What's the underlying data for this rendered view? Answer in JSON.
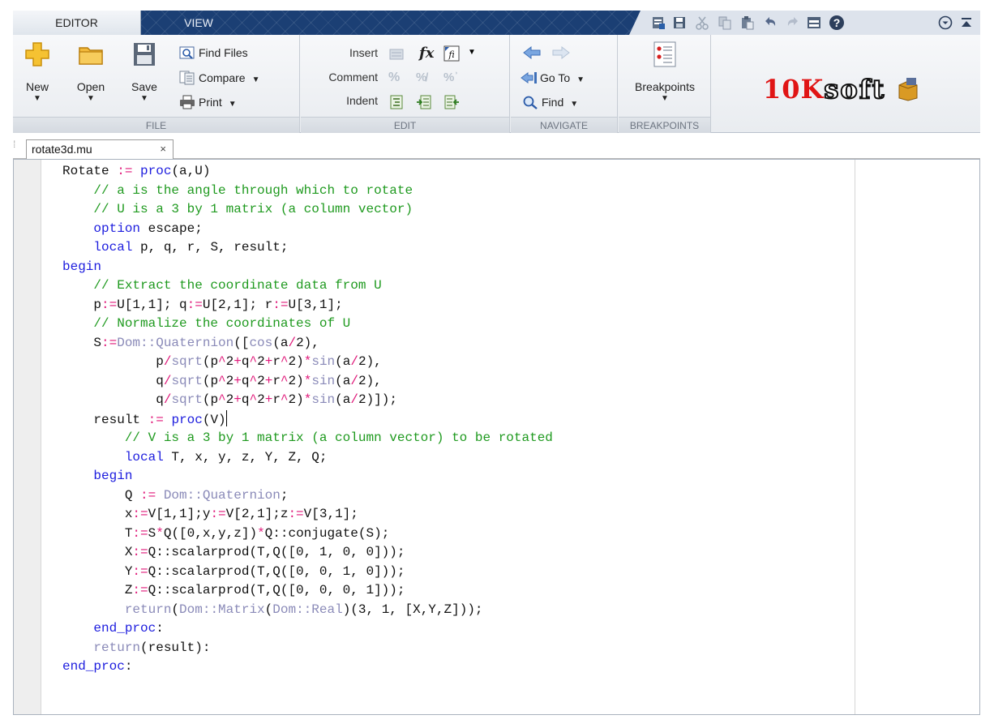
{
  "tabs": [
    {
      "label": "EDITOR"
    },
    {
      "label": "VIEW"
    }
  ],
  "quick_access": [
    "new-doc-icon",
    "save-icon",
    "cut-icon",
    "copy-icon",
    "paste-icon",
    "undo-icon",
    "redo-icon",
    "window-icon",
    "help-icon",
    "menu-chevron-icon",
    "collapse-icon"
  ],
  "ribbon": {
    "file": {
      "label": "FILE",
      "new": "New",
      "open": "Open",
      "save": "Save",
      "find_files": "Find Files",
      "compare": "Compare",
      "print": "Print"
    },
    "edit": {
      "label": "EDIT",
      "insert": "Insert",
      "comment": "Comment",
      "indent": "Indent"
    },
    "navigate": {
      "label": "NAVIGATE",
      "goto": "Go To",
      "find": "Find"
    },
    "breakpoints": {
      "label": "BREAKPOINTS",
      "button": "Breakpoints"
    }
  },
  "logo": {
    "text_a": "10K",
    "text_b": "soft"
  },
  "file_tab": {
    "name": "rotate3d.mu",
    "close": "×"
  },
  "colors": {
    "keyword": "#1d1dde",
    "comment": "#1f9a1f",
    "function": "#8a8ab8",
    "operator": "#e0197a"
  },
  "code_lines": [
    [
      [
        "tx",
        "Rotate "
      ],
      [
        "op",
        ":="
      ],
      [
        "tx",
        " "
      ],
      [
        "kw",
        "proc"
      ],
      [
        "tx",
        "(a,U)"
      ]
    ],
    [
      [
        "tx",
        "    "
      ],
      [
        "cm",
        "// a is the angle through which to rotate"
      ]
    ],
    [
      [
        "tx",
        "    "
      ],
      [
        "cm",
        "// U is a 3 by 1 matrix (a column vector)"
      ]
    ],
    [
      [
        "tx",
        "    "
      ],
      [
        "kw",
        "option"
      ],
      [
        "tx",
        " escape;"
      ]
    ],
    [
      [
        "tx",
        "    "
      ],
      [
        "kw",
        "local"
      ],
      [
        "tx",
        " p, q, r, S, result;"
      ]
    ],
    [
      [
        "kw",
        "begin"
      ]
    ],
    [
      [
        "tx",
        "    "
      ],
      [
        "cm",
        "// Extract the coordinate data from U"
      ]
    ],
    [
      [
        "tx",
        "    p"
      ],
      [
        "op",
        ":="
      ],
      [
        "tx",
        "U[1,1]; q"
      ],
      [
        "op",
        ":="
      ],
      [
        "tx",
        "U[2,1]; r"
      ],
      [
        "op",
        ":="
      ],
      [
        "tx",
        "U[3,1];"
      ]
    ],
    [
      [
        "tx",
        "    "
      ],
      [
        "cm",
        "// Normalize the coordinates of U"
      ]
    ],
    [
      [
        "tx",
        "    S"
      ],
      [
        "op",
        ":="
      ],
      [
        "fn",
        "Dom::Quaternion"
      ],
      [
        "tx",
        "(["
      ],
      [
        "fn",
        "cos"
      ],
      [
        "tx",
        "(a"
      ],
      [
        "op",
        "/"
      ],
      [
        "tx",
        "2),"
      ]
    ],
    [
      [
        "tx",
        "            p"
      ],
      [
        "op",
        "/"
      ],
      [
        "fn",
        "sqrt"
      ],
      [
        "tx",
        "(p"
      ],
      [
        "op",
        "^"
      ],
      [
        "tx",
        "2"
      ],
      [
        "op",
        "+"
      ],
      [
        "tx",
        "q"
      ],
      [
        "op",
        "^"
      ],
      [
        "tx",
        "2"
      ],
      [
        "op",
        "+"
      ],
      [
        "tx",
        "r"
      ],
      [
        "op",
        "^"
      ],
      [
        "tx",
        "2)"
      ],
      [
        "op",
        "*"
      ],
      [
        "fn",
        "sin"
      ],
      [
        "tx",
        "(a"
      ],
      [
        "op",
        "/"
      ],
      [
        "tx",
        "2),"
      ]
    ],
    [
      [
        "tx",
        "            q"
      ],
      [
        "op",
        "/"
      ],
      [
        "fn",
        "sqrt"
      ],
      [
        "tx",
        "(p"
      ],
      [
        "op",
        "^"
      ],
      [
        "tx",
        "2"
      ],
      [
        "op",
        "+"
      ],
      [
        "tx",
        "q"
      ],
      [
        "op",
        "^"
      ],
      [
        "tx",
        "2"
      ],
      [
        "op",
        "+"
      ],
      [
        "tx",
        "r"
      ],
      [
        "op",
        "^"
      ],
      [
        "tx",
        "2)"
      ],
      [
        "op",
        "*"
      ],
      [
        "fn",
        "sin"
      ],
      [
        "tx",
        "(a"
      ],
      [
        "op",
        "/"
      ],
      [
        "tx",
        "2),"
      ]
    ],
    [
      [
        "tx",
        "            q"
      ],
      [
        "op",
        "/"
      ],
      [
        "fn",
        "sqrt"
      ],
      [
        "tx",
        "(p"
      ],
      [
        "op",
        "^"
      ],
      [
        "tx",
        "2"
      ],
      [
        "op",
        "+"
      ],
      [
        "tx",
        "q"
      ],
      [
        "op",
        "^"
      ],
      [
        "tx",
        "2"
      ],
      [
        "op",
        "+"
      ],
      [
        "tx",
        "r"
      ],
      [
        "op",
        "^"
      ],
      [
        "tx",
        "2)"
      ],
      [
        "op",
        "*"
      ],
      [
        "fn",
        "sin"
      ],
      [
        "tx",
        "(a"
      ],
      [
        "op",
        "/"
      ],
      [
        "tx",
        "2)]);"
      ]
    ],
    [
      [
        "tx",
        "    result "
      ],
      [
        "op",
        ":="
      ],
      [
        "tx",
        " "
      ],
      [
        "kw",
        "proc"
      ],
      [
        "tx",
        "(V)"
      ],
      [
        "caret",
        ""
      ]
    ],
    [
      [
        "tx",
        "        "
      ],
      [
        "cm",
        "// V is a 3 by 1 matrix (a column vector) to be rotated"
      ]
    ],
    [
      [
        "tx",
        "        "
      ],
      [
        "kw",
        "local"
      ],
      [
        "tx",
        " T, x, y, z, Y, Z, Q;"
      ]
    ],
    [
      [
        "tx",
        "    "
      ],
      [
        "kw",
        "begin"
      ]
    ],
    [
      [
        "tx",
        "        Q "
      ],
      [
        "op",
        ":="
      ],
      [
        "tx",
        " "
      ],
      [
        "fn",
        "Dom::Quaternion"
      ],
      [
        "tx",
        ";"
      ]
    ],
    [
      [
        "tx",
        "        x"
      ],
      [
        "op",
        ":="
      ],
      [
        "tx",
        "V[1,1];y"
      ],
      [
        "op",
        ":="
      ],
      [
        "tx",
        "V[2,1];z"
      ],
      [
        "op",
        ":="
      ],
      [
        "tx",
        "V[3,1];"
      ]
    ],
    [
      [
        "tx",
        "        T"
      ],
      [
        "op",
        ":="
      ],
      [
        "tx",
        "S"
      ],
      [
        "op",
        "*"
      ],
      [
        "tx",
        "Q([0,x,y,z])"
      ],
      [
        "op",
        "*"
      ],
      [
        "tx",
        "Q::conjugate(S);"
      ]
    ],
    [
      [
        "tx",
        "        X"
      ],
      [
        "op",
        ":="
      ],
      [
        "tx",
        "Q::scalarprod(T,Q([0, 1, 0, 0]));"
      ]
    ],
    [
      [
        "tx",
        "        Y"
      ],
      [
        "op",
        ":="
      ],
      [
        "tx",
        "Q::scalarprod(T,Q([0, 0, 1, 0]));"
      ]
    ],
    [
      [
        "tx",
        "        Z"
      ],
      [
        "op",
        ":="
      ],
      [
        "tx",
        "Q::scalarprod(T,Q([0, 0, 0, 1]));"
      ]
    ],
    [
      [
        "tx",
        "        "
      ],
      [
        "fn",
        "return"
      ],
      [
        "tx",
        "("
      ],
      [
        "fn",
        "Dom::Matrix"
      ],
      [
        "tx",
        "("
      ],
      [
        "fn",
        "Dom::Real"
      ],
      [
        "tx",
        ")(3, 1, [X,Y,Z]));"
      ]
    ],
    [
      [
        "tx",
        "    "
      ],
      [
        "kw",
        "end_proc"
      ],
      [
        "tx",
        ":"
      ]
    ],
    [
      [
        "tx",
        "    "
      ],
      [
        "fn",
        "return"
      ],
      [
        "tx",
        "(result):"
      ]
    ],
    [
      [
        "kw",
        "end_proc"
      ],
      [
        "tx",
        ":"
      ]
    ]
  ]
}
